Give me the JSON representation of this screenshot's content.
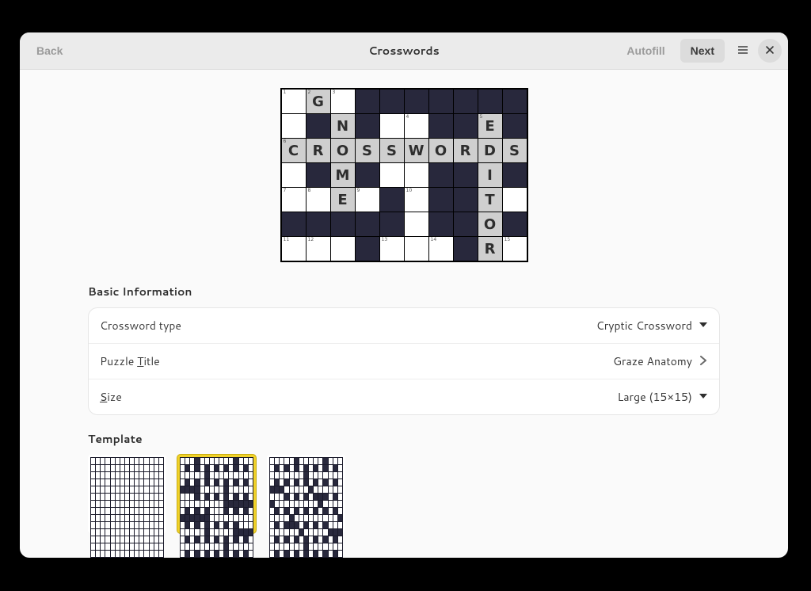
{
  "header": {
    "back": "Back",
    "title": "Crosswords",
    "autofill": "Autofill",
    "next": "Next"
  },
  "preview": {
    "rows": 7,
    "cols": 10,
    "cells": [
      [
        {
          "n": 1
        },
        {
          "n": 2,
          "l": "G",
          "g": 1
        },
        {
          "n": 3
        },
        {
          "c": "b"
        },
        {
          "c": "b"
        },
        {
          "c": "b"
        },
        {
          "c": "b"
        },
        {
          "c": "b"
        },
        {
          "c": "b"
        },
        {
          "c": "b"
        }
      ],
      [
        {},
        {
          "c": "b"
        },
        {
          "l": "N",
          "g": 1
        },
        {
          "c": "b"
        },
        {},
        {
          "n": 4
        },
        {
          "c": "b"
        },
        {
          "c": "b"
        },
        {
          "n": 5,
          "l": "E",
          "g": 1
        },
        {
          "c": "b"
        }
      ],
      [
        {
          "n": 6,
          "l": "C",
          "g": 1
        },
        {
          "l": "R",
          "g": 1
        },
        {
          "l": "O",
          "g": 1
        },
        {
          "l": "S",
          "g": 1
        },
        {
          "l": "S",
          "g": 1
        },
        {
          "l": "W",
          "g": 1
        },
        {
          "l": "O",
          "g": 1
        },
        {
          "l": "R",
          "g": 1
        },
        {
          "l": "D",
          "g": 1
        },
        {
          "l": "S",
          "g": 1
        }
      ],
      [
        {},
        {
          "c": "b"
        },
        {
          "l": "M",
          "g": 1
        },
        {
          "c": "b"
        },
        {},
        {},
        {
          "c": "b"
        },
        {
          "c": "b"
        },
        {
          "l": "I",
          "g": 1
        },
        {
          "c": "b"
        }
      ],
      [
        {
          "n": 7
        },
        {
          "n": 8
        },
        {
          "l": "E",
          "g": 1
        },
        {
          "n": 9
        },
        {
          "c": "b"
        },
        {
          "n": 10
        },
        {
          "c": "b"
        },
        {
          "c": "b"
        },
        {
          "l": "T",
          "g": 1
        },
        {}
      ],
      [
        {
          "c": "b"
        },
        {
          "c": "b"
        },
        {
          "c": "b"
        },
        {
          "c": "b"
        },
        {
          "c": "b"
        },
        {},
        {
          "c": "b"
        },
        {
          "c": "b"
        },
        {
          "l": "O",
          "g": 1
        },
        {
          "c": "b"
        }
      ],
      [
        {
          "n": 11
        },
        {
          "n": 12
        },
        {},
        {
          "c": "b"
        },
        {
          "n": 13
        },
        {},
        {
          "n": 14
        },
        {
          "c": "b"
        },
        {
          "l": "R",
          "g": 1
        },
        {
          "n": 15
        }
      ]
    ]
  },
  "basic": {
    "heading": "Basic Information",
    "type_label": "Crossword type",
    "type_value": "Cryptic Crossword",
    "title_label_pre": "Puzzle ",
    "title_label_access": "T",
    "title_label_post": "itle",
    "title_value": "Graze Anatomy",
    "size_label_access": "S",
    "size_label_post": "ize",
    "size_value": "Large (15×15)"
  },
  "template": {
    "heading": "Template",
    "items": [
      {
        "id": 0,
        "black": [],
        "selected": false
      },
      {
        "id": 1,
        "selected": true,
        "black": [
          [
            0,
            3
          ],
          [
            0,
            11
          ],
          [
            1,
            1
          ],
          [
            1,
            3
          ],
          [
            1,
            5
          ],
          [
            1,
            7
          ],
          [
            1,
            9
          ],
          [
            1,
            11
          ],
          [
            1,
            13
          ],
          [
            2,
            5
          ],
          [
            3,
            1
          ],
          [
            3,
            3
          ],
          [
            3,
            5
          ],
          [
            3,
            7
          ],
          [
            3,
            9
          ],
          [
            3,
            11
          ],
          [
            3,
            13
          ],
          [
            4,
            0
          ],
          [
            4,
            1
          ],
          [
            4,
            2
          ],
          [
            4,
            3
          ],
          [
            4,
            9
          ],
          [
            5,
            3
          ],
          [
            5,
            5
          ],
          [
            5,
            7
          ],
          [
            5,
            9
          ],
          [
            5,
            11
          ],
          [
            5,
            13
          ],
          [
            6,
            9
          ],
          [
            6,
            10
          ],
          [
            6,
            11
          ],
          [
            6,
            12
          ],
          [
            6,
            13
          ],
          [
            6,
            14
          ],
          [
            7,
            1
          ],
          [
            7,
            3
          ],
          [
            7,
            5
          ],
          [
            7,
            9
          ],
          [
            7,
            11
          ],
          [
            7,
            13
          ],
          [
            8,
            0
          ],
          [
            8,
            1
          ],
          [
            8,
            2
          ],
          [
            8,
            3
          ],
          [
            8,
            4
          ],
          [
            8,
            5
          ],
          [
            9,
            1
          ],
          [
            9,
            3
          ],
          [
            9,
            5
          ],
          [
            9,
            7
          ],
          [
            9,
            9
          ],
          [
            9,
            11
          ],
          [
            10,
            5
          ],
          [
            10,
            11
          ],
          [
            10,
            12
          ],
          [
            10,
            13
          ],
          [
            10,
            14
          ],
          [
            11,
            1
          ],
          [
            11,
            3
          ],
          [
            11,
            5
          ],
          [
            11,
            7
          ],
          [
            11,
            9
          ],
          [
            11,
            11
          ],
          [
            11,
            13
          ],
          [
            12,
            9
          ],
          [
            13,
            1
          ],
          [
            13,
            3
          ],
          [
            13,
            5
          ],
          [
            13,
            7
          ],
          [
            13,
            9
          ],
          [
            13,
            11
          ],
          [
            13,
            13
          ],
          [
            14,
            3
          ],
          [
            14,
            11
          ]
        ]
      },
      {
        "id": 2,
        "selected": false,
        "black": [
          [
            0,
            5
          ],
          [
            0,
            11
          ],
          [
            1,
            1
          ],
          [
            1,
            3
          ],
          [
            1,
            5
          ],
          [
            1,
            7
          ],
          [
            1,
            9
          ],
          [
            1,
            11
          ],
          [
            1,
            13
          ],
          [
            2,
            7
          ],
          [
            3,
            1
          ],
          [
            3,
            3
          ],
          [
            3,
            5
          ],
          [
            3,
            7
          ],
          [
            3,
            9
          ],
          [
            3,
            11
          ],
          [
            3,
            13
          ],
          [
            4,
            0
          ],
          [
            4,
            1
          ],
          [
            4,
            2
          ],
          [
            4,
            8
          ],
          [
            5,
            3
          ],
          [
            5,
            5
          ],
          [
            5,
            7
          ],
          [
            5,
            9
          ],
          [
            5,
            10
          ],
          [
            5,
            11
          ],
          [
            5,
            13
          ],
          [
            6,
            0
          ],
          [
            6,
            10
          ],
          [
            7,
            1
          ],
          [
            7,
            3
          ],
          [
            7,
            5
          ],
          [
            7,
            7
          ],
          [
            7,
            9
          ],
          [
            7,
            11
          ],
          [
            7,
            13
          ],
          [
            8,
            4
          ],
          [
            8,
            14
          ],
          [
            9,
            1
          ],
          [
            9,
            3
          ],
          [
            9,
            4
          ],
          [
            9,
            5
          ],
          [
            9,
            7
          ],
          [
            9,
            9
          ],
          [
            9,
            11
          ],
          [
            10,
            6
          ],
          [
            10,
            12
          ],
          [
            10,
            13
          ],
          [
            10,
            14
          ],
          [
            11,
            1
          ],
          [
            11,
            3
          ],
          [
            11,
            5
          ],
          [
            11,
            7
          ],
          [
            11,
            9
          ],
          [
            11,
            11
          ],
          [
            11,
            13
          ],
          [
            12,
            7
          ],
          [
            13,
            1
          ],
          [
            13,
            3
          ],
          [
            13,
            5
          ],
          [
            13,
            7
          ],
          [
            13,
            9
          ],
          [
            13,
            11
          ],
          [
            13,
            13
          ],
          [
            14,
            3
          ],
          [
            14,
            9
          ]
        ]
      }
    ]
  }
}
